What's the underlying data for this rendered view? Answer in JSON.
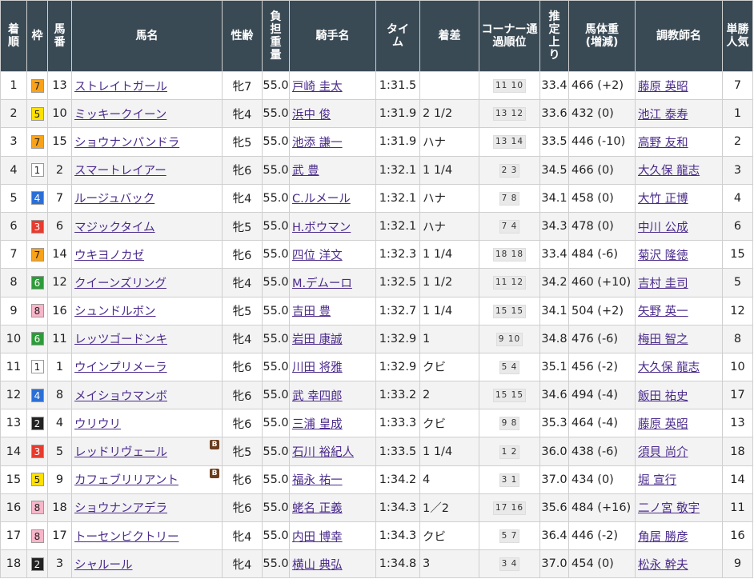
{
  "headers": [
    "着順",
    "枠",
    "馬番",
    "馬名",
    "性齢",
    "負担重量",
    "騎手名",
    "タイム",
    "着差",
    "コーナー通過順位",
    "推定上り",
    "馬体重(増減)",
    "調教師名",
    "単勝人気"
  ],
  "waku_colors": {
    "1": {
      "bg": "#ffffff",
      "fg": "#222222"
    },
    "2": {
      "bg": "#222222",
      "fg": "#ffffff"
    },
    "3": {
      "bg": "#e63b2e",
      "fg": "#ffffff"
    },
    "4": {
      "bg": "#2b6fd6",
      "fg": "#ffffff"
    },
    "5": {
      "bg": "#ffe100",
      "fg": "#222222"
    },
    "6": {
      "bg": "#2e9b3a",
      "fg": "#ffffff"
    },
    "7": {
      "bg": "#f7a21b",
      "fg": "#222222"
    },
    "8": {
      "bg": "#f7b6c9",
      "fg": "#222222"
    }
  },
  "blinker_label": "B",
  "rows": [
    {
      "rank": "1",
      "waku": "7",
      "num": "13",
      "horse": "ストレイトガール",
      "blinker": false,
      "sex_age": "牝7",
      "weight": "55.0",
      "jockey": "戸崎 圭太",
      "time": "1:31.5",
      "margin": "",
      "corner": "11 10",
      "last3f": "33.4",
      "body": "466 (+2)",
      "trainer": "藤原 英昭",
      "pop": "7"
    },
    {
      "rank": "2",
      "waku": "5",
      "num": "10",
      "horse": "ミッキークイーン",
      "blinker": false,
      "sex_age": "牝4",
      "weight": "55.0",
      "jockey": "浜中 俊",
      "time": "1:31.9",
      "margin": "2 1/2",
      "corner": "13 12",
      "last3f": "33.6",
      "body": "432 (0)",
      "trainer": "池江 泰寿",
      "pop": "1"
    },
    {
      "rank": "3",
      "waku": "7",
      "num": "15",
      "horse": "ショウナンパンドラ",
      "blinker": false,
      "sex_age": "牝5",
      "weight": "55.0",
      "jockey": "池添 謙一",
      "time": "1:31.9",
      "margin": "ハナ",
      "corner": "13 14",
      "last3f": "33.5",
      "body": "446 (-10)",
      "trainer": "高野 友和",
      "pop": "2"
    },
    {
      "rank": "4",
      "waku": "1",
      "num": "2",
      "horse": "スマートレイアー",
      "blinker": false,
      "sex_age": "牝6",
      "weight": "55.0",
      "jockey": "武 豊",
      "time": "1:32.1",
      "margin": "1 1/4",
      "corner": "2 3",
      "last3f": "34.5",
      "body": "466 (0)",
      "trainer": "大久保 龍志",
      "pop": "3"
    },
    {
      "rank": "5",
      "waku": "4",
      "num": "7",
      "horse": "ルージュバック",
      "blinker": false,
      "sex_age": "牝4",
      "weight": "55.0",
      "jockey": "C.ルメール",
      "time": "1:32.1",
      "margin": "ハナ",
      "corner": "7 8",
      "last3f": "34.1",
      "body": "458 (0)",
      "trainer": "大竹 正博",
      "pop": "4"
    },
    {
      "rank": "6",
      "waku": "3",
      "num": "6",
      "horse": "マジックタイム",
      "blinker": false,
      "sex_age": "牝5",
      "weight": "55.0",
      "jockey": "H.ボウマン",
      "time": "1:32.1",
      "margin": "ハナ",
      "corner": "7 4",
      "last3f": "34.3",
      "body": "478 (0)",
      "trainer": "中川 公成",
      "pop": "6"
    },
    {
      "rank": "7",
      "waku": "7",
      "num": "14",
      "horse": "ウキヨノカゼ",
      "blinker": false,
      "sex_age": "牝6",
      "weight": "55.0",
      "jockey": "四位 洋文",
      "time": "1:32.3",
      "margin": "1 1/4",
      "corner": "18 18",
      "last3f": "33.4",
      "body": "484 (-6)",
      "trainer": "菊沢 隆徳",
      "pop": "15"
    },
    {
      "rank": "8",
      "waku": "6",
      "num": "12",
      "horse": "クイーンズリング",
      "blinker": false,
      "sex_age": "牝4",
      "weight": "55.0",
      "jockey": "M.デムーロ",
      "time": "1:32.5",
      "margin": "1 1/2",
      "corner": "11 12",
      "last3f": "34.2",
      "body": "460 (+10)",
      "trainer": "吉村 圭司",
      "pop": "5"
    },
    {
      "rank": "9",
      "waku": "8",
      "num": "16",
      "horse": "シュンドルボン",
      "blinker": false,
      "sex_age": "牝5",
      "weight": "55.0",
      "jockey": "吉田 豊",
      "time": "1:32.7",
      "margin": "1 1/4",
      "corner": "15 15",
      "last3f": "34.1",
      "body": "504 (+2)",
      "trainer": "矢野 英一",
      "pop": "12"
    },
    {
      "rank": "10",
      "waku": "6",
      "num": "11",
      "horse": "レッツゴードンキ",
      "blinker": false,
      "sex_age": "牝4",
      "weight": "55.0",
      "jockey": "岩田 康誠",
      "time": "1:32.9",
      "margin": "1",
      "corner": "9 10",
      "last3f": "34.8",
      "body": "476 (-6)",
      "trainer": "梅田 智之",
      "pop": "8"
    },
    {
      "rank": "11",
      "waku": "1",
      "num": "1",
      "horse": "ウインプリメーラ",
      "blinker": false,
      "sex_age": "牝6",
      "weight": "55.0",
      "jockey": "川田 将雅",
      "time": "1:32.9",
      "margin": "クビ",
      "corner": "5 4",
      "last3f": "35.1",
      "body": "456 (-2)",
      "trainer": "大久保 龍志",
      "pop": "10"
    },
    {
      "rank": "12",
      "waku": "4",
      "num": "8",
      "horse": "メイショウマンボ",
      "blinker": false,
      "sex_age": "牝6",
      "weight": "55.0",
      "jockey": "武 幸四郎",
      "time": "1:33.2",
      "margin": "2",
      "corner": "15 15",
      "last3f": "34.6",
      "body": "494 (-4)",
      "trainer": "飯田 祐史",
      "pop": "17"
    },
    {
      "rank": "13",
      "waku": "2",
      "num": "4",
      "horse": "ウリウリ",
      "blinker": false,
      "sex_age": "牝6",
      "weight": "55.0",
      "jockey": "三浦 皇成",
      "time": "1:33.3",
      "margin": "クビ",
      "corner": "9 8",
      "last3f": "35.3",
      "body": "464 (-4)",
      "trainer": "藤原 英昭",
      "pop": "13"
    },
    {
      "rank": "14",
      "waku": "3",
      "num": "5",
      "horse": "レッドリヴェール",
      "blinker": true,
      "sex_age": "牝5",
      "weight": "55.0",
      "jockey": "石川 裕紀人",
      "time": "1:33.5",
      "margin": "1 1/4",
      "corner": "1 2",
      "last3f": "36.0",
      "body": "438 (-6)",
      "trainer": "須貝 尚介",
      "pop": "18"
    },
    {
      "rank": "15",
      "waku": "5",
      "num": "9",
      "horse": "カフェブリリアント",
      "blinker": true,
      "sex_age": "牝6",
      "weight": "55.0",
      "jockey": "福永 祐一",
      "time": "1:34.2",
      "margin": "4",
      "corner": "3 1",
      "last3f": "37.0",
      "body": "434 (0)",
      "trainer": "堀 宣行",
      "pop": "14"
    },
    {
      "rank": "16",
      "waku": "8",
      "num": "18",
      "horse": "ショウナンアデラ",
      "blinker": false,
      "sex_age": "牝6",
      "weight": "55.0",
      "jockey": "蛯名 正義",
      "time": "1:34.3",
      "margin": "1／2",
      "corner": "17 16",
      "last3f": "35.6",
      "body": "484 (+16)",
      "trainer": "二ノ宮 敬宇",
      "pop": "11"
    },
    {
      "rank": "17",
      "waku": "8",
      "num": "17",
      "horse": "トーセンビクトリー",
      "blinker": false,
      "sex_age": "牝4",
      "weight": "55.0",
      "jockey": "内田 博幸",
      "time": "1:34.3",
      "margin": "クビ",
      "corner": "5 7",
      "last3f": "36.4",
      "body": "446 (-2)",
      "trainer": "角居 勝彦",
      "pop": "16"
    },
    {
      "rank": "18",
      "waku": "2",
      "num": "3",
      "horse": "シャルール",
      "blinker": false,
      "sex_age": "牝4",
      "weight": "55.0",
      "jockey": "横山 典弘",
      "time": "1:34.8",
      "margin": "3",
      "corner": "3 4",
      "last3f": "37.0",
      "body": "454 (0)",
      "trainer": "松永 幹夫",
      "pop": "9"
    }
  ]
}
